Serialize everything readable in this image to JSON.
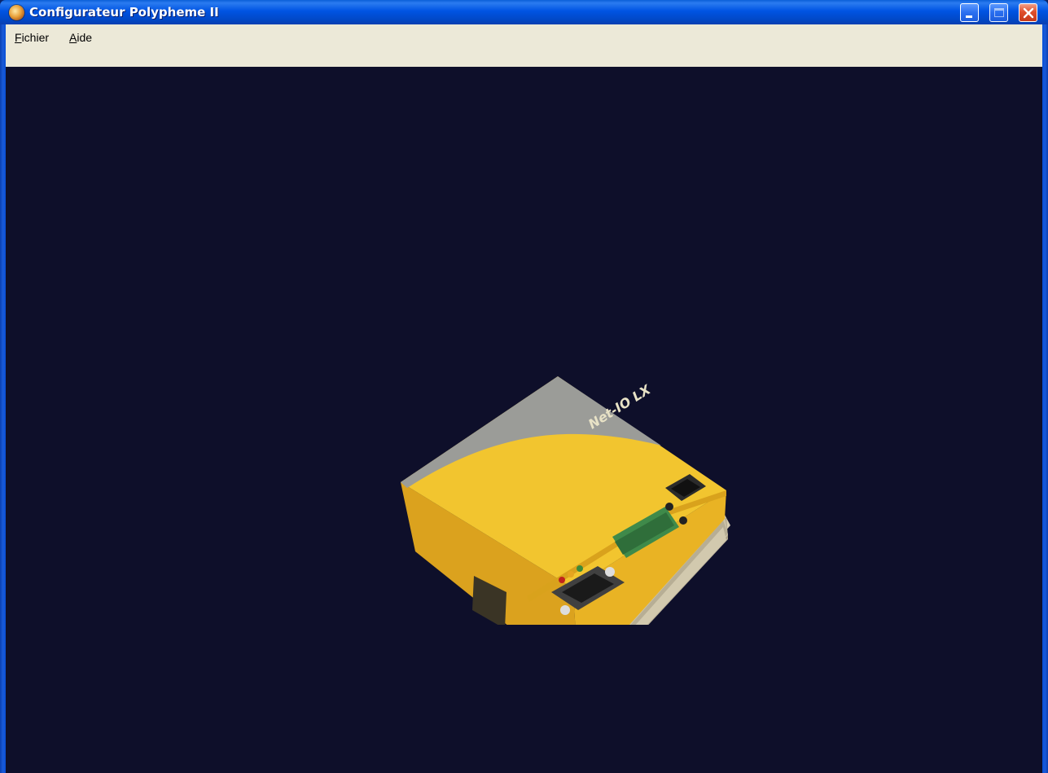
{
  "window": {
    "title": "Configurateur Polypheme II",
    "icon": "polypheme-app-icon",
    "controls": {
      "minimize": "minimize-icon",
      "maximize": "maximize-icon",
      "close": "close-icon"
    }
  },
  "menu": {
    "items": [
      {
        "label": "Fichier",
        "accel": "F",
        "rest": "ichier"
      },
      {
        "label": "Aide",
        "accel": "A",
        "rest": "ide"
      }
    ]
  },
  "device": {
    "label": "Net-IO LX"
  },
  "colors": {
    "background": "#0e0f2a",
    "titlebar": "#0054e3",
    "menubar": "#ece9d8",
    "device_body": "#f2c12e"
  }
}
